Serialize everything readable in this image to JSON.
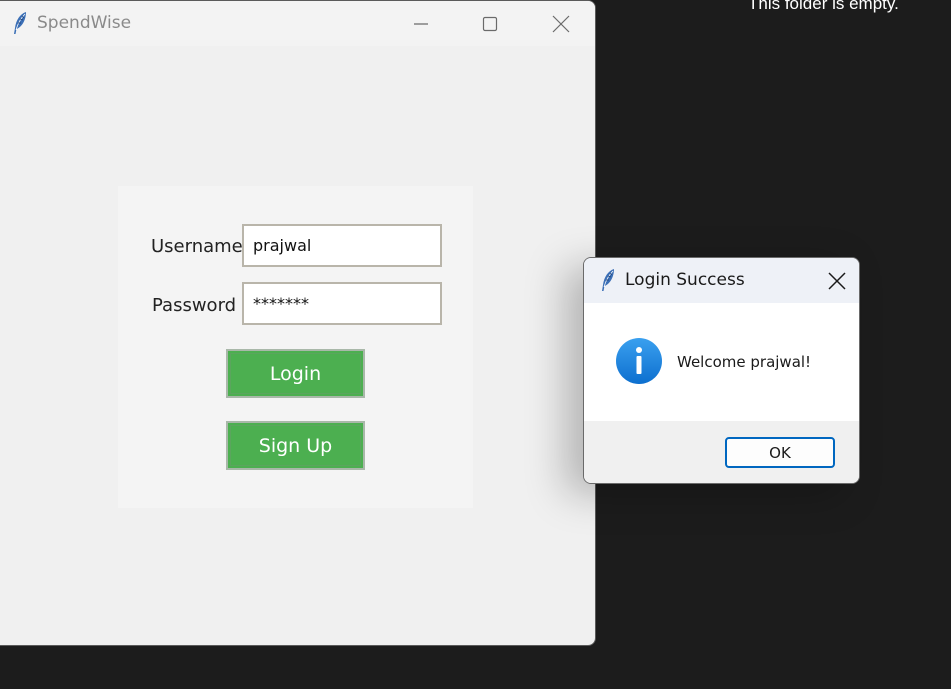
{
  "desktop": {
    "empty_folder_text": "This folder is empty."
  },
  "main_window": {
    "title": "SpendWise",
    "icon": "feather-icon",
    "controls": [
      "minimize-icon",
      "maximize-icon",
      "close-icon"
    ],
    "form": {
      "username_label": "Username",
      "username_value": "prajwal",
      "password_label": "Password",
      "password_value": "*******",
      "login_label": "Login",
      "signup_label": "Sign Up"
    }
  },
  "dialog": {
    "title": "Login Success",
    "icon": "feather-icon",
    "message_icon": "info-icon",
    "message": "Welcome prajwal!",
    "ok_label": "OK"
  },
  "colors": {
    "button_green": "#4caf50",
    "info_blue": "#1e88e5",
    "ok_border": "#0067c0",
    "desktop_bg": "#1c1c1c"
  }
}
